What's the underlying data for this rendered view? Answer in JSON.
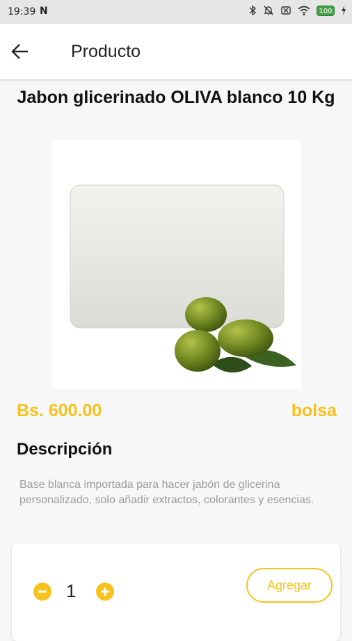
{
  "status_bar": {
    "time": "19:39",
    "notification": "N",
    "battery": "100",
    "icons": [
      "bluetooth-icon",
      "bell-off-icon",
      "sim-off-icon",
      "wifi-icon",
      "battery-icon",
      "charging-icon"
    ]
  },
  "app_bar": {
    "title": "Producto",
    "back_icon": "arrow-back-icon"
  },
  "product": {
    "title": "Jabon glicerinado OLIVA blanco 10 Kg",
    "price": "Bs. 600.00",
    "unit": "bolsa",
    "description_heading": "Descripción",
    "description": "Base blanca importada para hacer jabón de glicerina personalizado, solo añadir extractos, colorantes y esencias."
  },
  "cart": {
    "quantity": "1",
    "add_label": "Agregar"
  },
  "colors": {
    "accent": "#f7c21d",
    "status_bar": "#e6e6e6",
    "background": "#f7f7f7"
  }
}
